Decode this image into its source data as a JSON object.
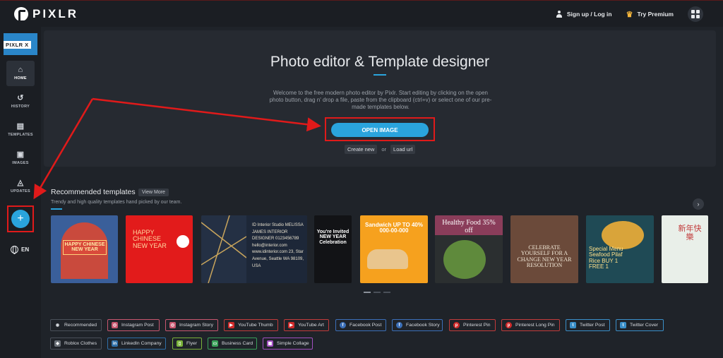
{
  "header": {
    "logo": "PIXLR",
    "signup": "Sign up / Log in",
    "premium": "Try Premium"
  },
  "sidebar": {
    "badge": "PIXLR X",
    "items": [
      {
        "label": "HOME",
        "icon": "home-icon"
      },
      {
        "label": "HISTORY",
        "icon": "history-icon"
      },
      {
        "label": "TEMPLATES",
        "icon": "templates-icon"
      },
      {
        "label": "IMAGES",
        "icon": "images-icon"
      },
      {
        "label": "UPDATES",
        "icon": "updates-icon"
      }
    ],
    "add": "+",
    "language": "EN"
  },
  "hero": {
    "title": "Photo editor & Template designer",
    "description": "Welcome to the free modern photo editor by Pixlr. Start editing by clicking on the open photo button, drag n' drop a file, paste from the clipboard (ctrl+v) or select one of our pre-made templates below.",
    "open_button": "OPEN IMAGE",
    "create_new": "Create new",
    "or": "or",
    "load_url": "Load url"
  },
  "recommended": {
    "title": "Recommended templates",
    "view_more": "View More",
    "subtitle": "Trendy and high quality templates hand picked by our team."
  },
  "templates": [
    {
      "text": "HAPPY CHINESE NEW YEAR"
    },
    {
      "text": "HAPPY CHINESE NEW YEAR"
    },
    {
      "text": "ID Interior Studio MELISSA JAMES INTERIOR DESIGNER 0123456789 hello@interior.com www.idinterior.com 23, Star Avenue, Seattle WA 98109, USA"
    },
    {
      "text": "You're Invited NEW YEAR Celebration"
    },
    {
      "text": "Sandwich UP TO 40% 000-00-000"
    },
    {
      "text": "Healthy Food 35% off"
    },
    {
      "text": "CELEBRATE YOURSELF FOR A CHANGE NEW YEAR RESOLUTION"
    },
    {
      "text": "Special Menu Seafood Pilaf Rice BUY 1 FREE 1"
    },
    {
      "text": "新年快樂"
    }
  ],
  "tags": [
    [
      "Recommended",
      "Instagram Post",
      "Instagram Story",
      "YouTube Thumb",
      "YouTube Art",
      "Facebook Post",
      "Facebook Story",
      "Pinterest Pin",
      "Pinterest Long Pin",
      "Twitter Post",
      "Twitter Cover"
    ],
    [
      "Roblox Clothes",
      "LinkedIn Company",
      "Flyer",
      "Business Card",
      "Simple Collage"
    ]
  ],
  "colors": {
    "accent": "#2aa4dd",
    "highlight_box": "#e01a1a",
    "background": "#1f2329"
  }
}
